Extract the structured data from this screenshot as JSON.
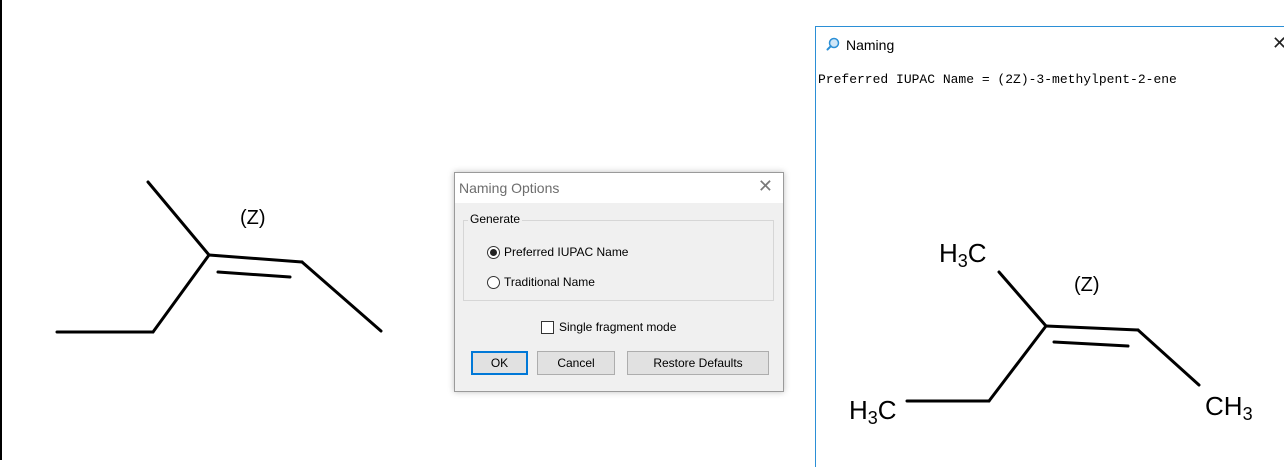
{
  "left_structure": {
    "stereo_label": "(Z)"
  },
  "naming_options_dialog": {
    "title": "Naming Options",
    "close_symbol": "✕",
    "group_label": "Generate",
    "radio_options": [
      {
        "label": "Preferred IUPAC Name",
        "selected": true
      },
      {
        "label": "Traditional Name",
        "selected": false
      }
    ],
    "checkbox": {
      "label": "Single fragment mode",
      "checked": false
    },
    "buttons": {
      "ok": "OK",
      "cancel": "Cancel",
      "restore": "Restore Defaults"
    }
  },
  "naming_window": {
    "title": "Naming",
    "close_symbol": "✕",
    "result_text": "Preferred IUPAC Name = (2Z)-3-methylpent-2-ene",
    "structure": {
      "stereo_label": "(Z)",
      "atom_top_left": {
        "main": "H",
        "sub": "3",
        "tail": "C"
      },
      "atom_bottom_left": {
        "main": "H",
        "sub": "3",
        "tail": "C"
      },
      "atom_right": {
        "main": "CH",
        "sub": "3"
      }
    }
  },
  "colors": {
    "window_border": "#2b8fd6",
    "default_button_border": "#0078d7",
    "dialog_background": "#f0f0f0"
  },
  "icons": {
    "naming_window_icon": "magnifier-icon"
  }
}
